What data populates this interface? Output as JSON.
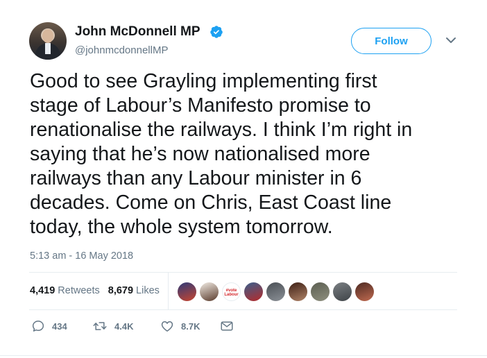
{
  "author": {
    "name": "John McDonnell MP",
    "handle": "@johnmcdonnellMP",
    "verified": true
  },
  "follow_label": "Follow",
  "tweet": {
    "text": "Good to see Grayling implementing first\nstage of Labour’s Manifesto promise to\nrenationalise the railways. I think I’m right in\nsaying that he’s now nationalised more\nrailways than any Labour minister in 6\ndecades. Come on Chris, East Coast line\ntoday, the whole system tomorrow.",
    "timestamp": "5:13 am - 16 May 2018"
  },
  "stats": {
    "retweets_count": "4,419",
    "retweets_label": "Retweets",
    "likes_count": "8,679",
    "likes_label": "Likes"
  },
  "liker_avatars": [
    {
      "label": "",
      "colors": [
        "#2e3a78",
        "#c8452f"
      ]
    },
    {
      "label": "",
      "colors": [
        "#f1ebe3",
        "#5a3b2c"
      ]
    },
    {
      "label": "#vote Labour",
      "colors": [
        "#ffffff",
        "#ffffff"
      ]
    },
    {
      "label": "",
      "colors": [
        "#3a5f8c",
        "#b52a2a"
      ]
    },
    {
      "label": "",
      "colors": [
        "#4a4f55",
        "#8b9096"
      ]
    },
    {
      "label": "",
      "colors": [
        "#3d1f15",
        "#b08468"
      ]
    },
    {
      "label": "",
      "colors": [
        "#5c5f52",
        "#8e8f7e"
      ]
    },
    {
      "label": "",
      "colors": [
        "#7a7f83",
        "#3f4448"
      ]
    },
    {
      "label": "",
      "colors": [
        "#4d2a22",
        "#c06a50"
      ]
    }
  ],
  "actions": {
    "reply_count": "434",
    "retweet_count": "4.4K",
    "like_count": "8.7K"
  },
  "colors": {
    "accent": "#1da1f2",
    "secondary_text": "#657786",
    "primary_text": "#14171a",
    "divider": "#e6ecf0"
  },
  "icons": [
    "verified-badge-icon",
    "chevron-down-icon",
    "reply-icon",
    "retweet-icon",
    "heart-icon",
    "envelope-icon"
  ]
}
